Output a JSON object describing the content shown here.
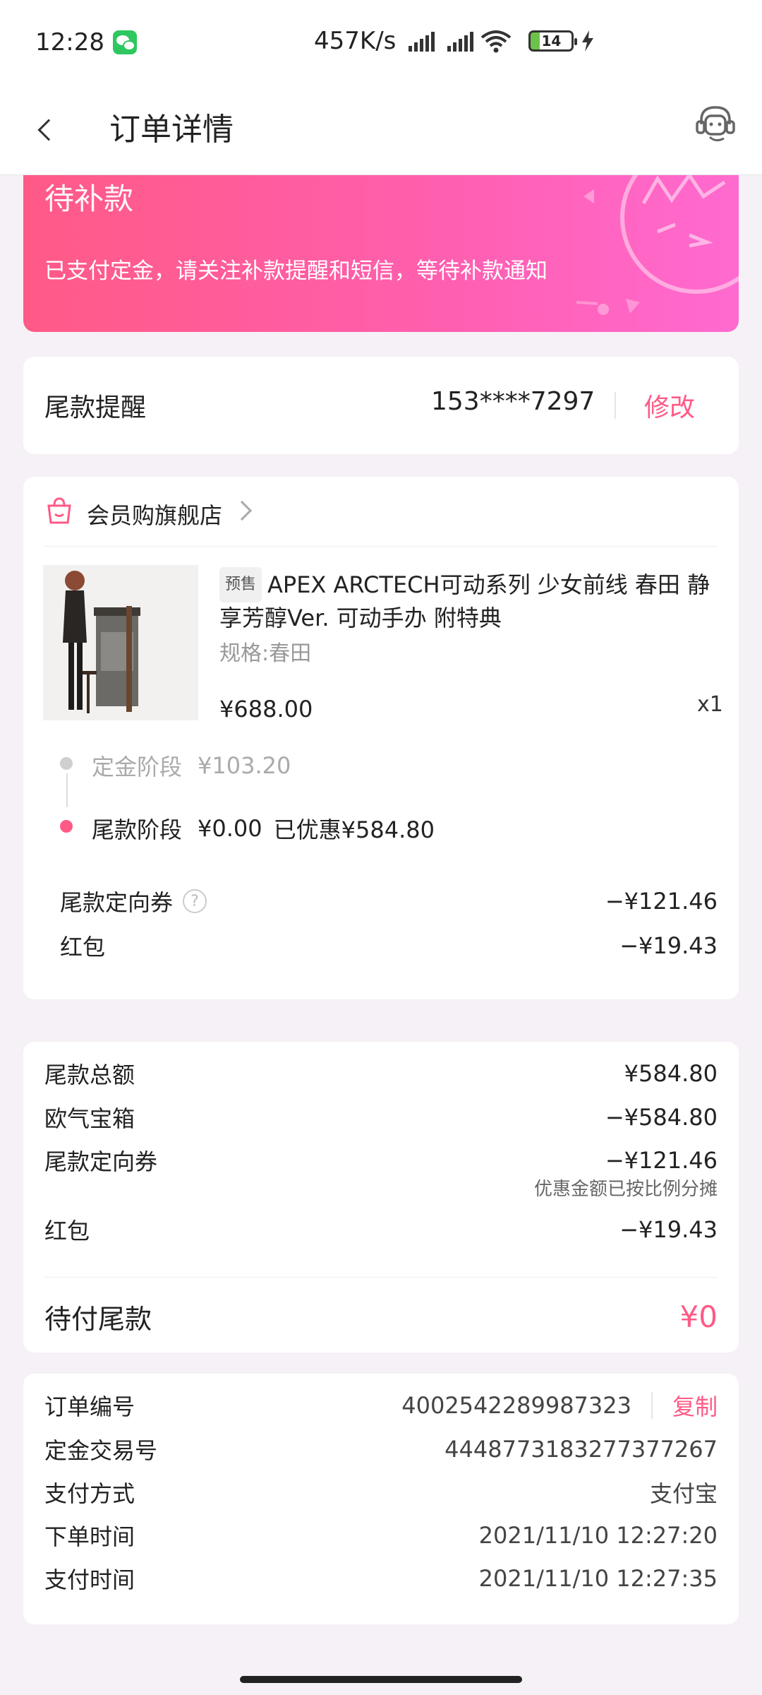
{
  "status_bar": {
    "time": "12:28",
    "speed": "457K/s",
    "battery": "14"
  },
  "nav": {
    "title": "订单详情"
  },
  "banner": {
    "title": "待补款",
    "desc": "已支付定金，请关注补款提醒和短信，等待补款通知"
  },
  "reminder": {
    "label": "尾款提醒",
    "phone": "153****7297",
    "edit_label": "修改"
  },
  "order": {
    "shop_name": "会员购旗舰店",
    "presale_tag": "预售",
    "product_title": "APEX ARCTECH可动系列 少女前线 春田 静享芳醇Ver. 可动手办 附特典",
    "spec": "规格:春田",
    "price": "¥688.00",
    "quantity": "x1",
    "deposit_stage": {
      "label": "定金阶段",
      "amount": "¥103.20"
    },
    "final_stage": {
      "label": "尾款阶段",
      "amount": "¥0.00",
      "discount": "已优惠¥584.80"
    },
    "coupon": {
      "label": "尾款定向券",
      "value": "−¥121.46"
    },
    "red_packet": {
      "label": "红包",
      "value": "−¥19.43"
    }
  },
  "summary": {
    "total": {
      "label": "尾款总额",
      "value": "¥584.80"
    },
    "lucky_box": {
      "label": "欧气宝箱",
      "value": "−¥584.80"
    },
    "coupon": {
      "label": "尾款定向券",
      "value": "−¥121.46"
    },
    "coupon_note": "优惠金额已按比例分摊",
    "red_packet": {
      "label": "红包",
      "value": "−¥19.43"
    },
    "due": {
      "label": "待付尾款",
      "value": "¥0"
    }
  },
  "info": {
    "order_no": {
      "label": "订单编号",
      "value": "4002542289987323",
      "copy_label": "复制"
    },
    "deposit_txn": {
      "label": "定金交易号",
      "value": "4448773183277377267"
    },
    "pay_method": {
      "label": "支付方式",
      "value": "支付宝"
    },
    "order_time": {
      "label": "下单时间",
      "value": "2021/11/10 12:27:20"
    },
    "pay_time": {
      "label": "支付时间",
      "value": "2021/11/10 12:27:35"
    }
  },
  "colors": {
    "accent": "#ff5a86",
    "banner_start": "#ff5a86",
    "banner_end": "#ff6ad0"
  }
}
